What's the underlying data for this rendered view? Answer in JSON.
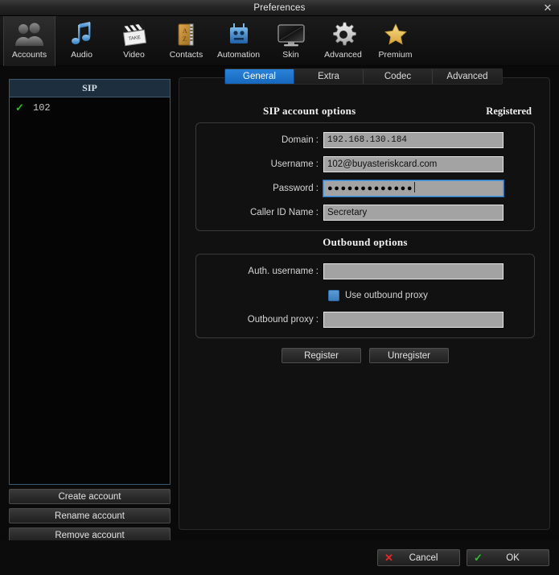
{
  "window": {
    "title": "Preferences",
    "close_label": "✕"
  },
  "toolbar": {
    "items": [
      {
        "label": "Accounts",
        "icon": "accounts-people-icon",
        "selected": true
      },
      {
        "label": "Audio",
        "icon": "audio-note-icon",
        "selected": false
      },
      {
        "label": "Video",
        "icon": "video-clapper-icon",
        "selected": false
      },
      {
        "label": "Contacts",
        "icon": "contacts-book-icon",
        "selected": false
      },
      {
        "label": "Automation",
        "icon": "automation-robot-icon",
        "selected": false
      },
      {
        "label": "Skin",
        "icon": "skin-monitor-icon",
        "selected": false
      },
      {
        "label": "Advanced",
        "icon": "advanced-gear-icon",
        "selected": false
      },
      {
        "label": "Premium",
        "icon": "premium-star-icon",
        "selected": false
      }
    ]
  },
  "sidebar": {
    "list_header": "SIP",
    "accounts": [
      {
        "name": "102",
        "enabled_mark": "✓"
      }
    ],
    "buttons": [
      {
        "label": "Create account"
      },
      {
        "label": "Rename account"
      },
      {
        "label": "Remove account"
      }
    ]
  },
  "tabs": [
    {
      "label": "General",
      "active": true
    },
    {
      "label": "Extra",
      "active": false
    },
    {
      "label": "Codec",
      "active": false
    },
    {
      "label": "Advanced",
      "active": false
    }
  ],
  "sip_section": {
    "title": "SIP account options",
    "status": "Registered",
    "fields": [
      {
        "label": "Domain :",
        "value": "192.168.130.184",
        "placeholder": "",
        "focused": false
      },
      {
        "label": "Username :",
        "value": "102@buyasteriskcard.com",
        "placeholder": "",
        "focused": false
      },
      {
        "label": "Password :",
        "value": "●●●●●●●●●●●●●",
        "placeholder": "",
        "focused": true
      },
      {
        "label": "Caller ID Name :",
        "value": "Secretary",
        "placeholder": "",
        "focused": false
      }
    ]
  },
  "outbound_section": {
    "title": "Outbound options",
    "auth_label": "Auth. username :",
    "auth_value": "",
    "checkbox_label": "Use outbound proxy",
    "checkbox_checked": false,
    "proxy_label": "Outbound proxy :",
    "proxy_value": ""
  },
  "action_buttons": [
    {
      "label": "Register"
    },
    {
      "label": "Unregister"
    }
  ],
  "footer": {
    "cancel_label": "Cancel",
    "cancel_icon": "✕",
    "ok_label": "OK",
    "ok_icon": "✓"
  },
  "colors": {
    "accent_blue": "#1668bd",
    "checkbox_blue": "#3c7ebd",
    "list_border": "#3c5a72",
    "list_header_bg": "#1d2f3e",
    "check_green": "#21c421",
    "cancel_red": "#e02b2b",
    "ok_green": "#27c527",
    "input_bg": "#a3a3a3",
    "window_bg": "#0a0a0a"
  }
}
